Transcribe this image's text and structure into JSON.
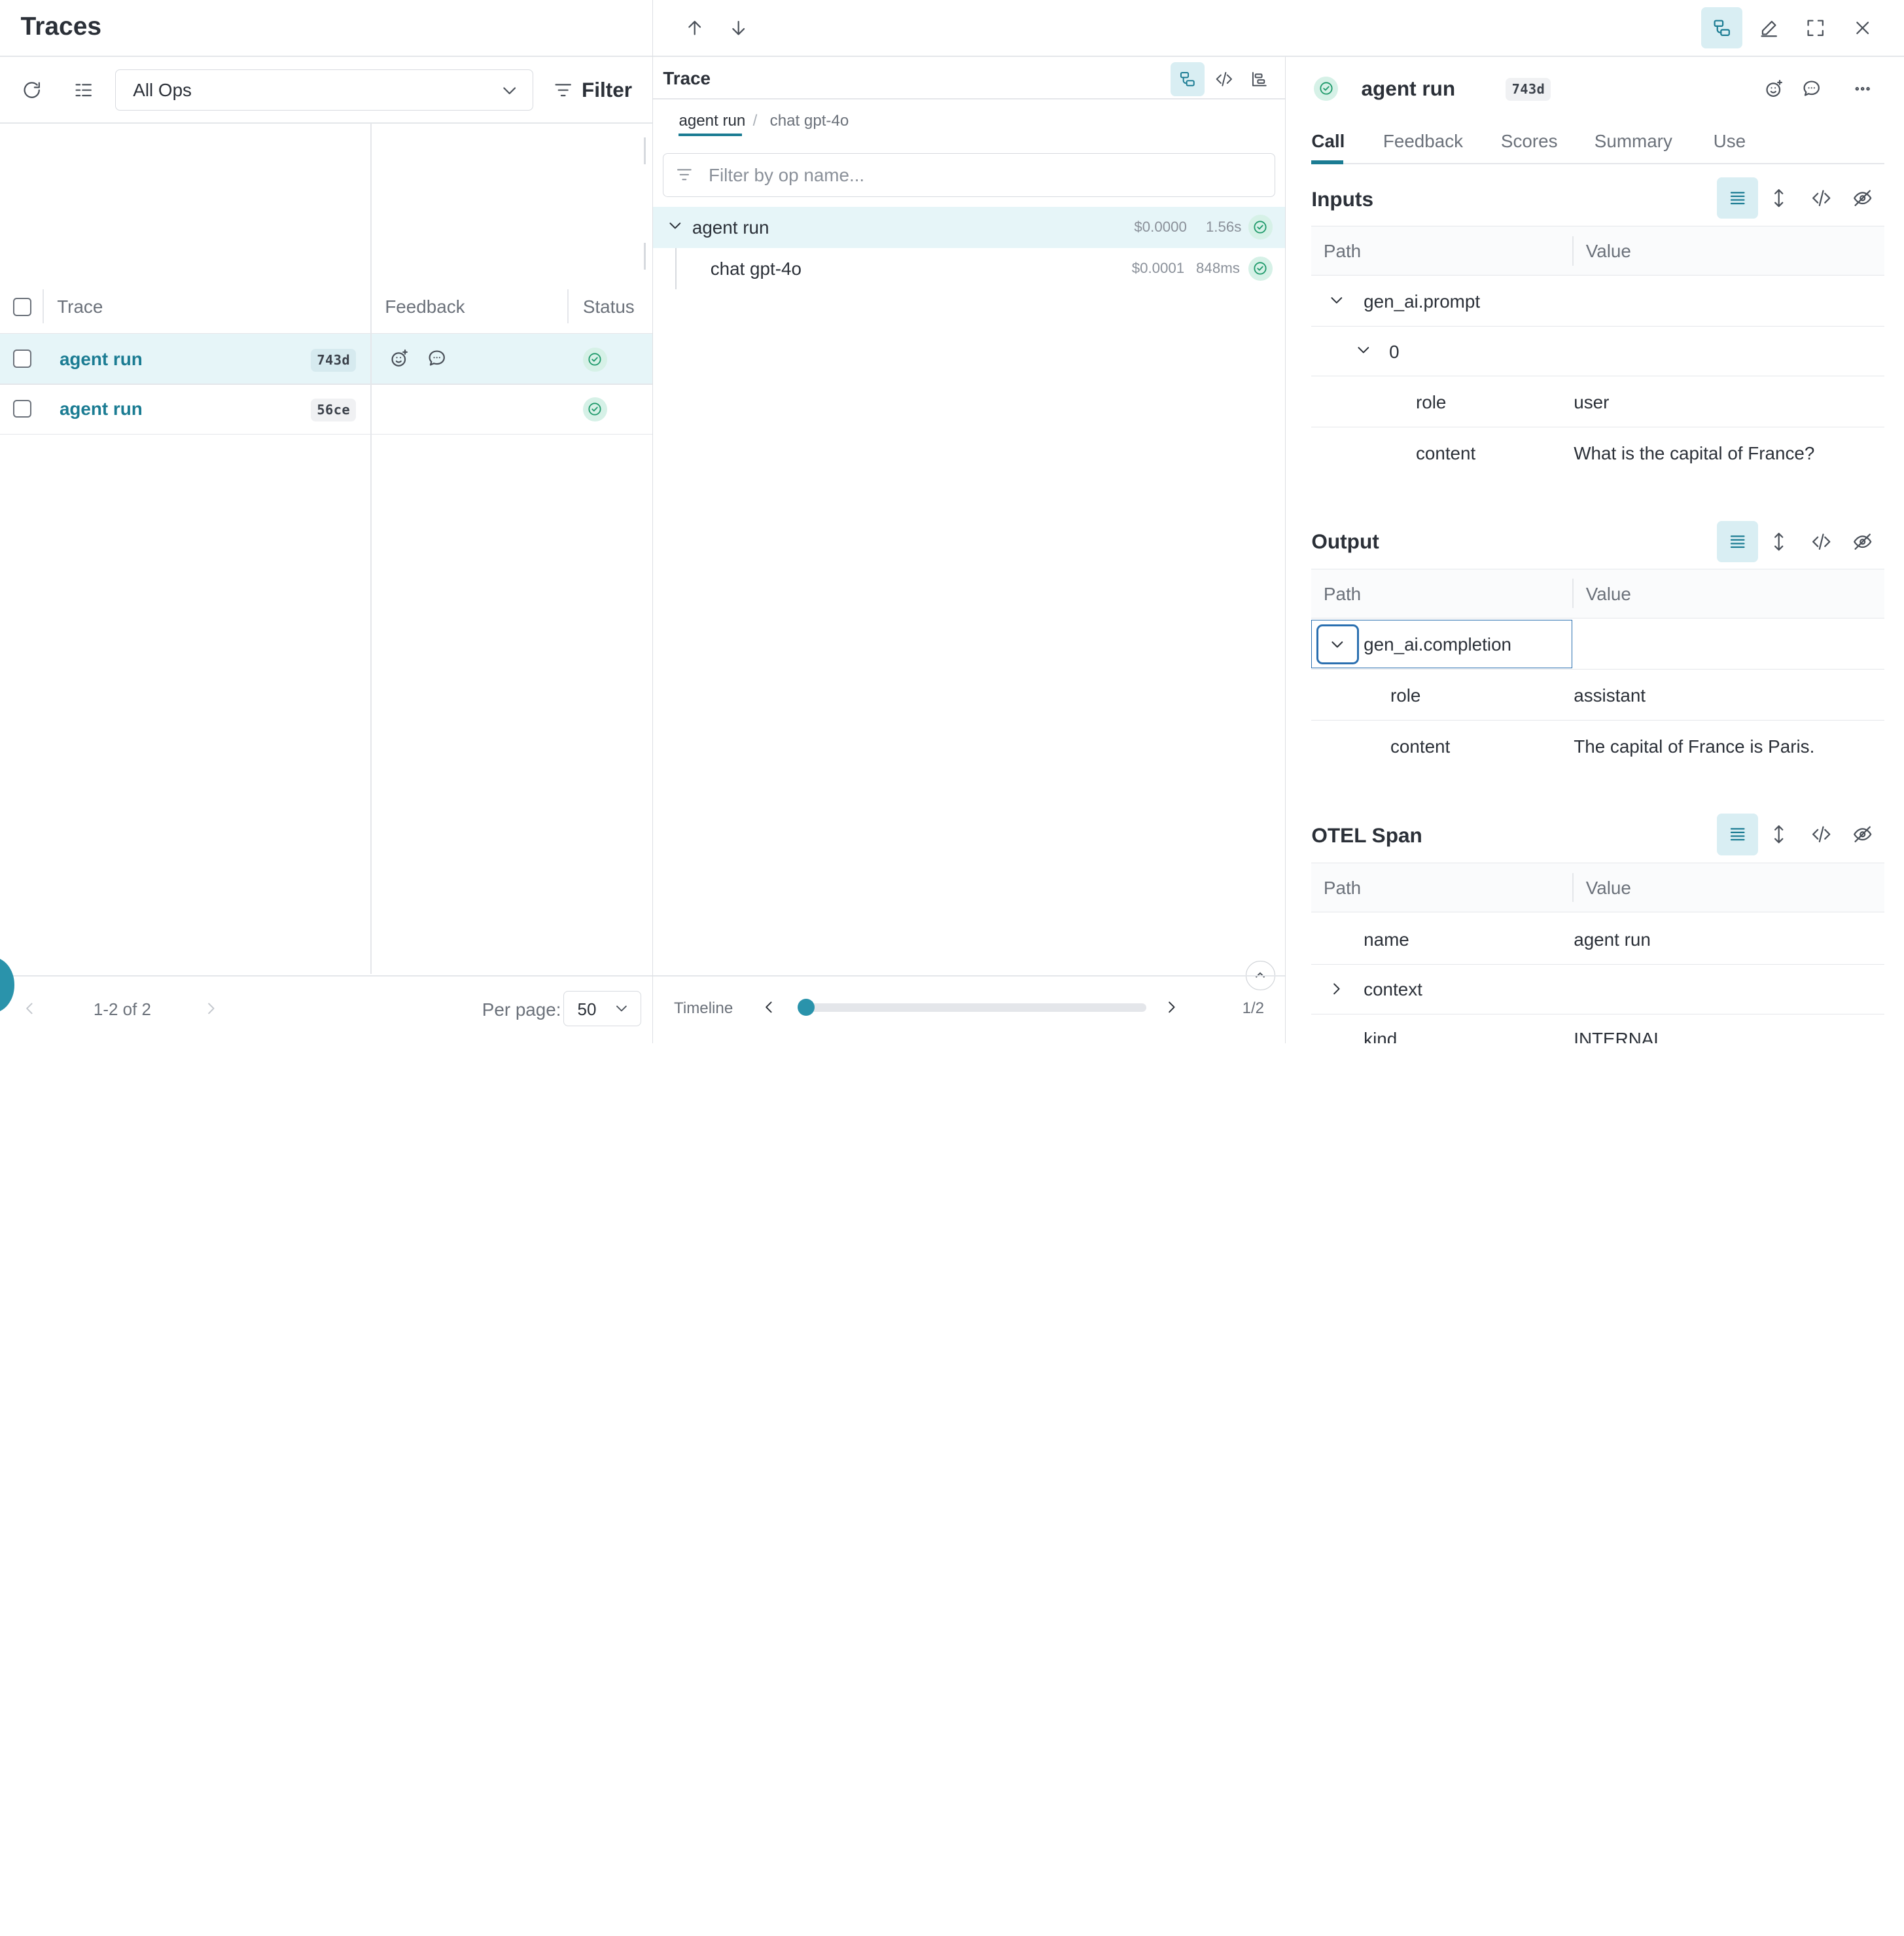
{
  "colors": {
    "accent": "#1b7c93",
    "success": "#1f9a6b",
    "selected_row": "#e6f5f8"
  },
  "left": {
    "title": "Traces",
    "ops_select": "All Ops",
    "filter_label": "Filter",
    "columns": {
      "trace": "Trace",
      "feedback": "Feedback",
      "status": "Status"
    },
    "rows": [
      {
        "name": "agent run",
        "id": "743d",
        "status": "success"
      },
      {
        "name": "agent run",
        "id": "56ce",
        "status": "success"
      }
    ],
    "pagination": {
      "range": "1-2 of 2",
      "per_page_label": "Per page:",
      "per_page_value": "50"
    }
  },
  "trace": {
    "title": "Trace",
    "breadcrumb": [
      "agent run",
      "chat gpt-4o"
    ],
    "filter_placeholder": "Filter by op name...",
    "items": [
      {
        "name": "agent run",
        "cost": "$0.0000",
        "duration": "1.56s"
      },
      {
        "name": "chat gpt-4o",
        "cost": "$0.0001",
        "duration": "848ms"
      }
    ],
    "timeline": {
      "label": "Timeline",
      "position": "1/2"
    }
  },
  "detail": {
    "title": "agent run",
    "id": "743d",
    "tabs": [
      "Call",
      "Feedback",
      "Scores",
      "Summary",
      "Use"
    ],
    "col_path": "Path",
    "col_value": "Value",
    "inputs": {
      "title": "Inputs",
      "rows": [
        {
          "path": "gen_ai.prompt",
          "value": ""
        },
        {
          "path": "0",
          "value": ""
        },
        {
          "path": "role",
          "value": "user"
        },
        {
          "path": "content",
          "value": "What is the capital of France?"
        }
      ]
    },
    "output": {
      "title": "Output",
      "rows": [
        {
          "path": "gen_ai.completion",
          "value": ""
        },
        {
          "path": "role",
          "value": "assistant"
        },
        {
          "path": "content",
          "value": "The capital of France is Paris."
        }
      ]
    },
    "otel": {
      "title": "OTEL Span",
      "rows": [
        {
          "path": "name",
          "value": "agent run"
        },
        {
          "path": "context",
          "value": ""
        },
        {
          "path": "kind",
          "value": "INTERNAL"
        }
      ]
    }
  }
}
